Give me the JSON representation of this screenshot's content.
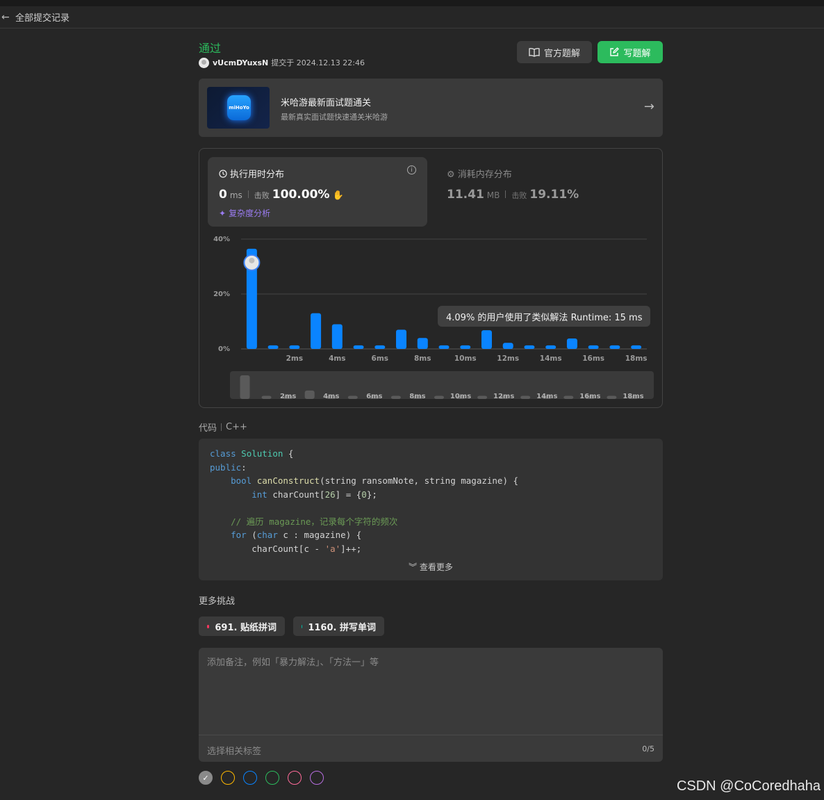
{
  "nav": {
    "back_label": "全部提交记录"
  },
  "submission": {
    "status": "通过",
    "username": "vUcmDYuxsN",
    "submitted_text": "提交于 2024.12.13 22:46"
  },
  "actions": {
    "official_label": "官方题解",
    "write_label": "写题解"
  },
  "banner": {
    "logo_text": "miHoYo",
    "title": "米哈游最新面试题通关",
    "subtitle": "最新真实面试题快速通关米哈游"
  },
  "runtime": {
    "title": "执行用时分布",
    "value": "0",
    "unit": "ms",
    "beat_label": "击败",
    "beat_pct": "100.00%",
    "complexity_label": "复杂度分析"
  },
  "memory": {
    "title": "消耗内存分布",
    "value": "11.41",
    "unit": "MB",
    "beat_label": "击败",
    "beat_pct": "19.11%"
  },
  "tooltip_text": "4.09% 的用户使用了类似解法 Runtime: 15 ms",
  "chart_data": {
    "type": "bar",
    "yticks": [
      "40%",
      "20%",
      "0%"
    ],
    "ylim": [
      0,
      40
    ],
    "xtick_labels": [
      "2ms",
      "4ms",
      "6ms",
      "8ms",
      "10ms",
      "12ms",
      "14ms",
      "16ms",
      "18ms"
    ],
    "x": [
      0,
      1,
      2,
      3,
      4,
      5,
      6,
      7,
      8,
      9,
      10,
      11,
      12,
      13,
      14,
      15,
      16,
      17,
      18
    ],
    "values": [
      36.5,
      1.3,
      1.3,
      13,
      9,
      1.3,
      1.3,
      7,
      4,
      1.3,
      1.3,
      6.8,
      2.2,
      1.3,
      1.3,
      3.8,
      1.3,
      1.3,
      1.3
    ],
    "highlight_index": 0,
    "bar_color": "#0a84ff",
    "grid": true,
    "overview_values": [
      9,
      1.2,
      1.2,
      3.2,
      1.2,
      1.2,
      1.2,
      1.2,
      1.2,
      1.2,
      1.2,
      1.2,
      1.2,
      1.2,
      1.2,
      1.2,
      1.2,
      1.2,
      1.2
    ]
  },
  "code": {
    "label": "代码",
    "language": "C++",
    "lines": [
      [
        [
          "kw",
          "class"
        ],
        [
          "",
          "",
          " "
        ],
        [
          "ty",
          "Solution"
        ],
        [
          "",
          "",
          " {"
        ]
      ],
      [
        [
          "kw",
          "public"
        ],
        [
          "",
          ":"
        ]
      ],
      [
        [
          "",
          "    "
        ],
        [
          "kw",
          "bool"
        ],
        [
          "",
          " "
        ],
        [
          "fn",
          "canConstruct"
        ],
        [
          "",
          "(string ransomNote, string magazine) {"
        ]
      ],
      [
        [
          "",
          "        "
        ],
        [
          "kw",
          "int"
        ],
        [
          "",
          " charCount["
        ],
        [
          "nm",
          "26"
        ],
        [
          "",
          "] = {"
        ],
        [
          "nm",
          "0"
        ],
        [
          "",
          "};"
        ]
      ],
      [
        [
          "",
          ""
        ]
      ],
      [
        [
          "",
          "    "
        ],
        [
          "cm",
          "// 遍历 magazine，记录每个字符的频次"
        ]
      ],
      [
        [
          "",
          "    "
        ],
        [
          "kw",
          "for"
        ],
        [
          "",
          " ("
        ],
        [
          "kw",
          "char"
        ],
        [
          "",
          " c : magazine) {"
        ]
      ],
      [
        [
          "",
          "        charCount[c - "
        ],
        [
          "st",
          "'a'"
        ],
        [
          "",
          "]++;"
        ]
      ]
    ],
    "more_label": "查看更多"
  },
  "challenges": {
    "title": "更多挑战",
    "items": [
      {
        "label": "691. 贴纸拼词",
        "dot_color": "#ff375f"
      },
      {
        "label": "1160. 拼写单词",
        "dot_color": "#00b8a3"
      }
    ]
  },
  "notes": {
    "placeholder": "添加备注，例如「暴力解法」、「方法一」等",
    "tag_placeholder": "选择相关标签",
    "tag_count": "0/5"
  },
  "note_colors": [
    "#8a8a8a",
    "#ffb800",
    "#0a84ff",
    "#2cbb5d",
    "#ff6b9a",
    "#b76ee0"
  ],
  "watermark": "CSDN @CoCoredhaha"
}
